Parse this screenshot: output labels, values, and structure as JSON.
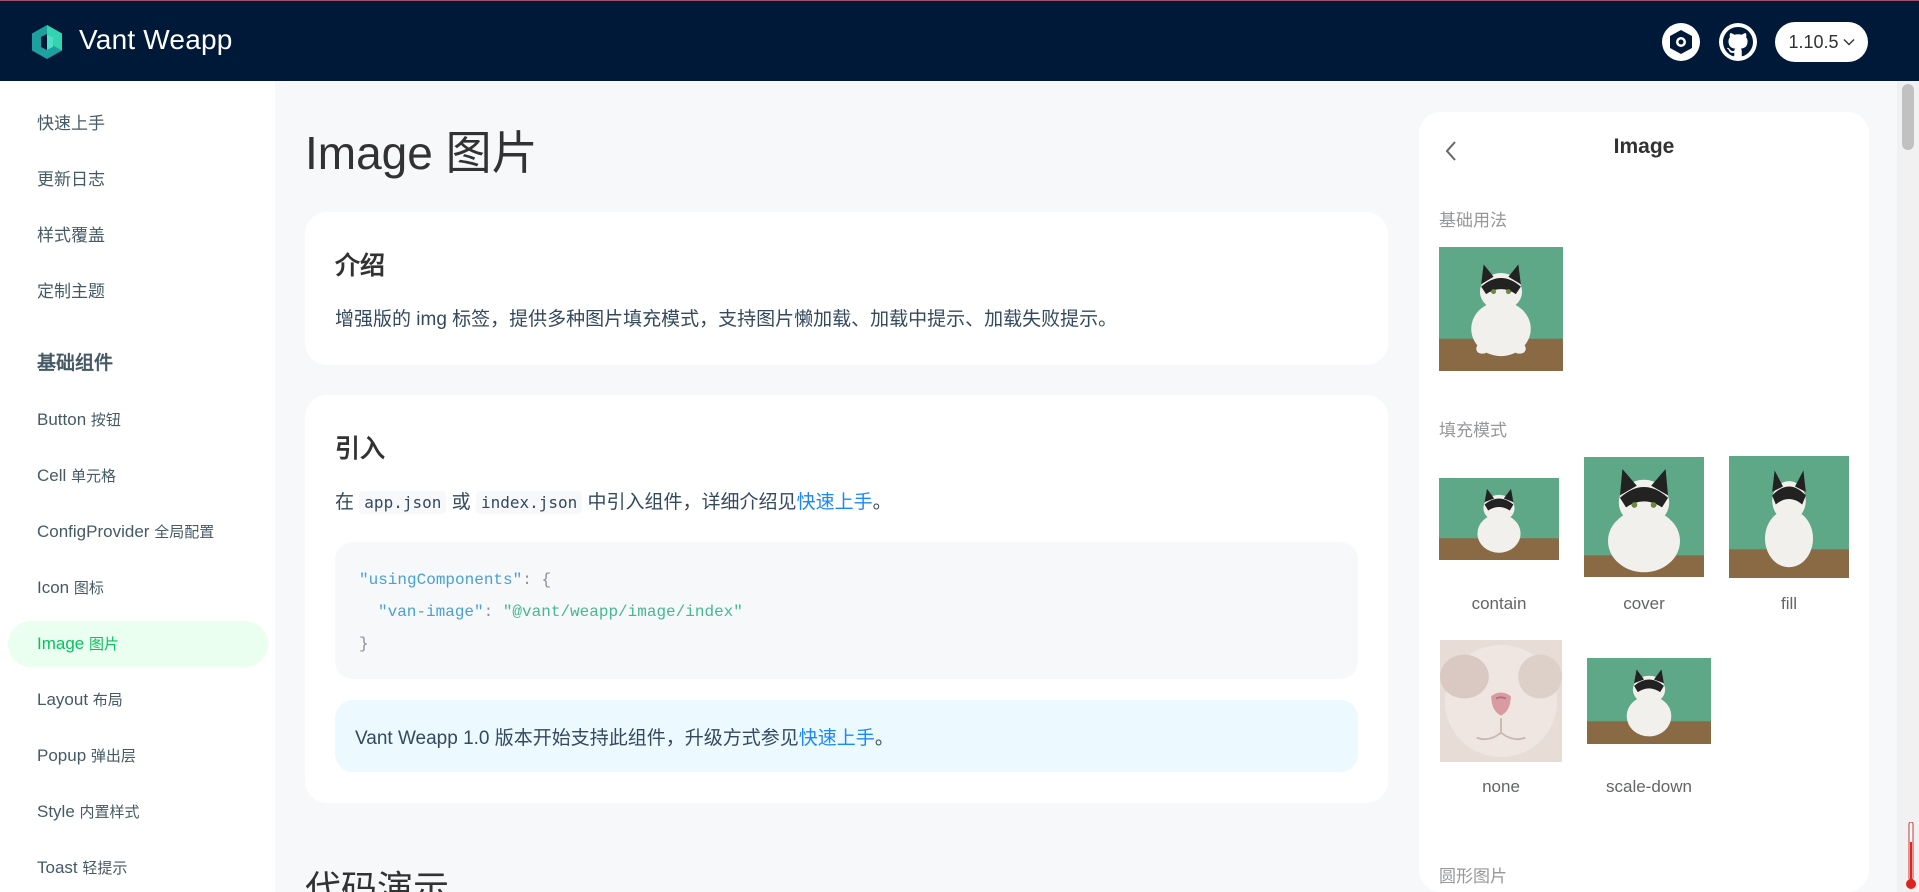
{
  "header": {
    "brand": "Vant Weapp",
    "version": "1.10.5"
  },
  "sidebar": {
    "items": [
      {
        "label": "快速上手"
      },
      {
        "label": "更新日志"
      },
      {
        "label": "样式覆盖"
      },
      {
        "label": "定制主题"
      }
    ],
    "group": "基础组件",
    "components": [
      {
        "name": "Button",
        "cn": "按钮"
      },
      {
        "name": "Cell",
        "cn": "单元格"
      },
      {
        "name": "ConfigProvider",
        "cn": "全局配置"
      },
      {
        "name": "Icon",
        "cn": "图标"
      },
      {
        "name": "Image",
        "cn": "图片"
      },
      {
        "name": "Layout",
        "cn": "布局"
      },
      {
        "name": "Popup",
        "cn": "弹出层"
      },
      {
        "name": "Style",
        "cn": "内置样式"
      },
      {
        "name": "Toast",
        "cn": "轻提示"
      }
    ],
    "active": "Image 图片"
  },
  "main": {
    "title": "Image 图片",
    "intro": {
      "heading": "介绍",
      "text": "增强版的 img 标签，提供多种图片填充模式，支持图片懒加载、加载中提示、加载失败提示。"
    },
    "import": {
      "heading": "引入",
      "text_before": "在",
      "file1": "app.json",
      "text_or": "或",
      "file2": "index.json",
      "text_after": "中引入组件，详细介绍见",
      "link": "快速上手",
      "period": "。",
      "code_line1_key": "\"usingComponents\"",
      "code_line1_rest": ": {",
      "code_line2_key": "\"van-image\"",
      "code_line2_sep": ": ",
      "code_line2_val": "\"@vant/weapp/image/index\"",
      "code_line3": "}"
    },
    "tip": {
      "text": "Vant Weapp 1.0 版本开始支持此组件，升级方式参见",
      "link": "快速上手",
      "period": "。"
    },
    "section": "代码演示"
  },
  "simulator": {
    "title": "Image",
    "basic_label": "基础用法",
    "fill_label": "填充模式",
    "captions": [
      "contain",
      "cover",
      "fill",
      "none",
      "scale-down"
    ],
    "round_label": "圆形图片"
  },
  "colors": {
    "header_bg": "#001938",
    "active": "#07c160",
    "link": "#1989fa"
  }
}
